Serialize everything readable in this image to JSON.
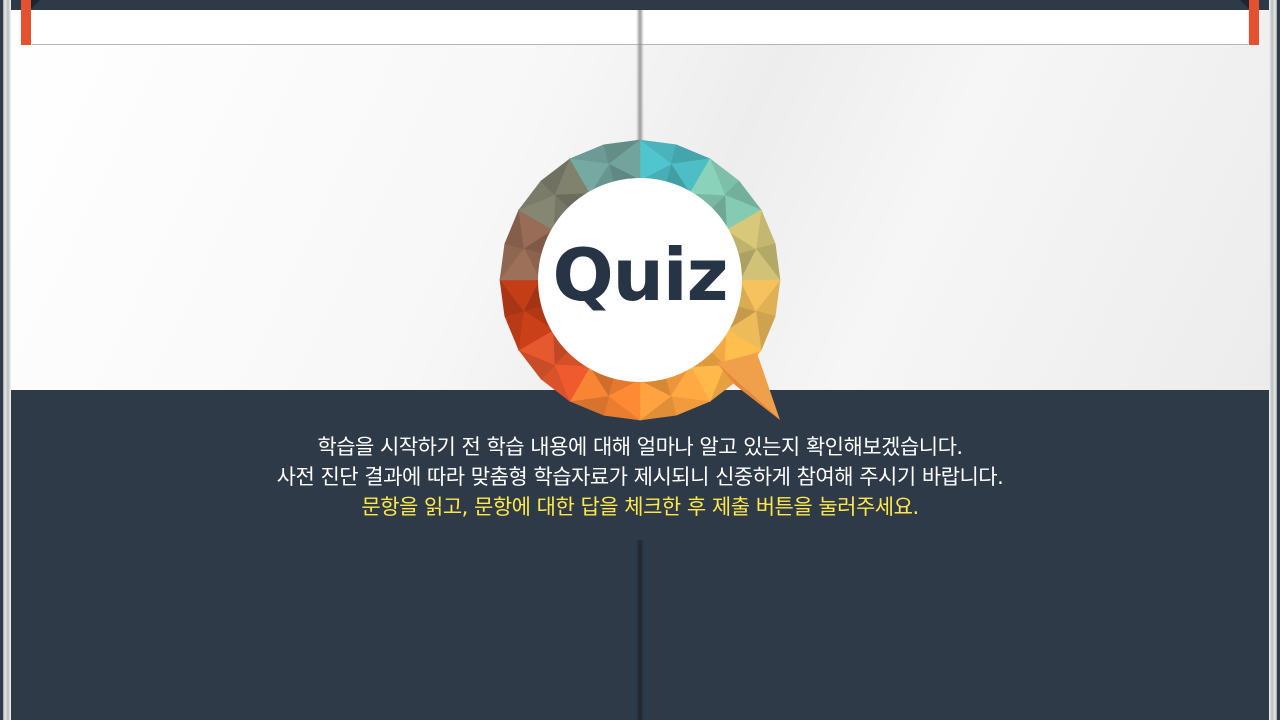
{
  "logo": {
    "text": "Quiz",
    "text_color": "#263445",
    "ring_colors": [
      "#4ab3bb",
      "#7dbfa8",
      "#c4b76f",
      "#e0b055",
      "#fbae45",
      "#f39a3c",
      "#ea7d30",
      "#d9532a",
      "#b83a16",
      "#8f6651",
      "#7a7b68",
      "#6c9a94"
    ]
  },
  "instructions": {
    "line1": "학습을 시작하기 전 학습 내용에 대해 얼마나 알고 있는지 확인해보겠습니다.",
    "line2": "사전 진단 결과에 따라 맞춤형 학습자료가 제시되니 신중하게 참여해 주시기 바랍니다.",
    "line3": "문항을 읽고, 문항에 대한 답을 체크한 후 제출 버튼을 눌러주세요."
  },
  "colors": {
    "background_dark": "#2e3a48",
    "bookmark": "#e4512e",
    "highlight_text": "#ffe84a"
  }
}
